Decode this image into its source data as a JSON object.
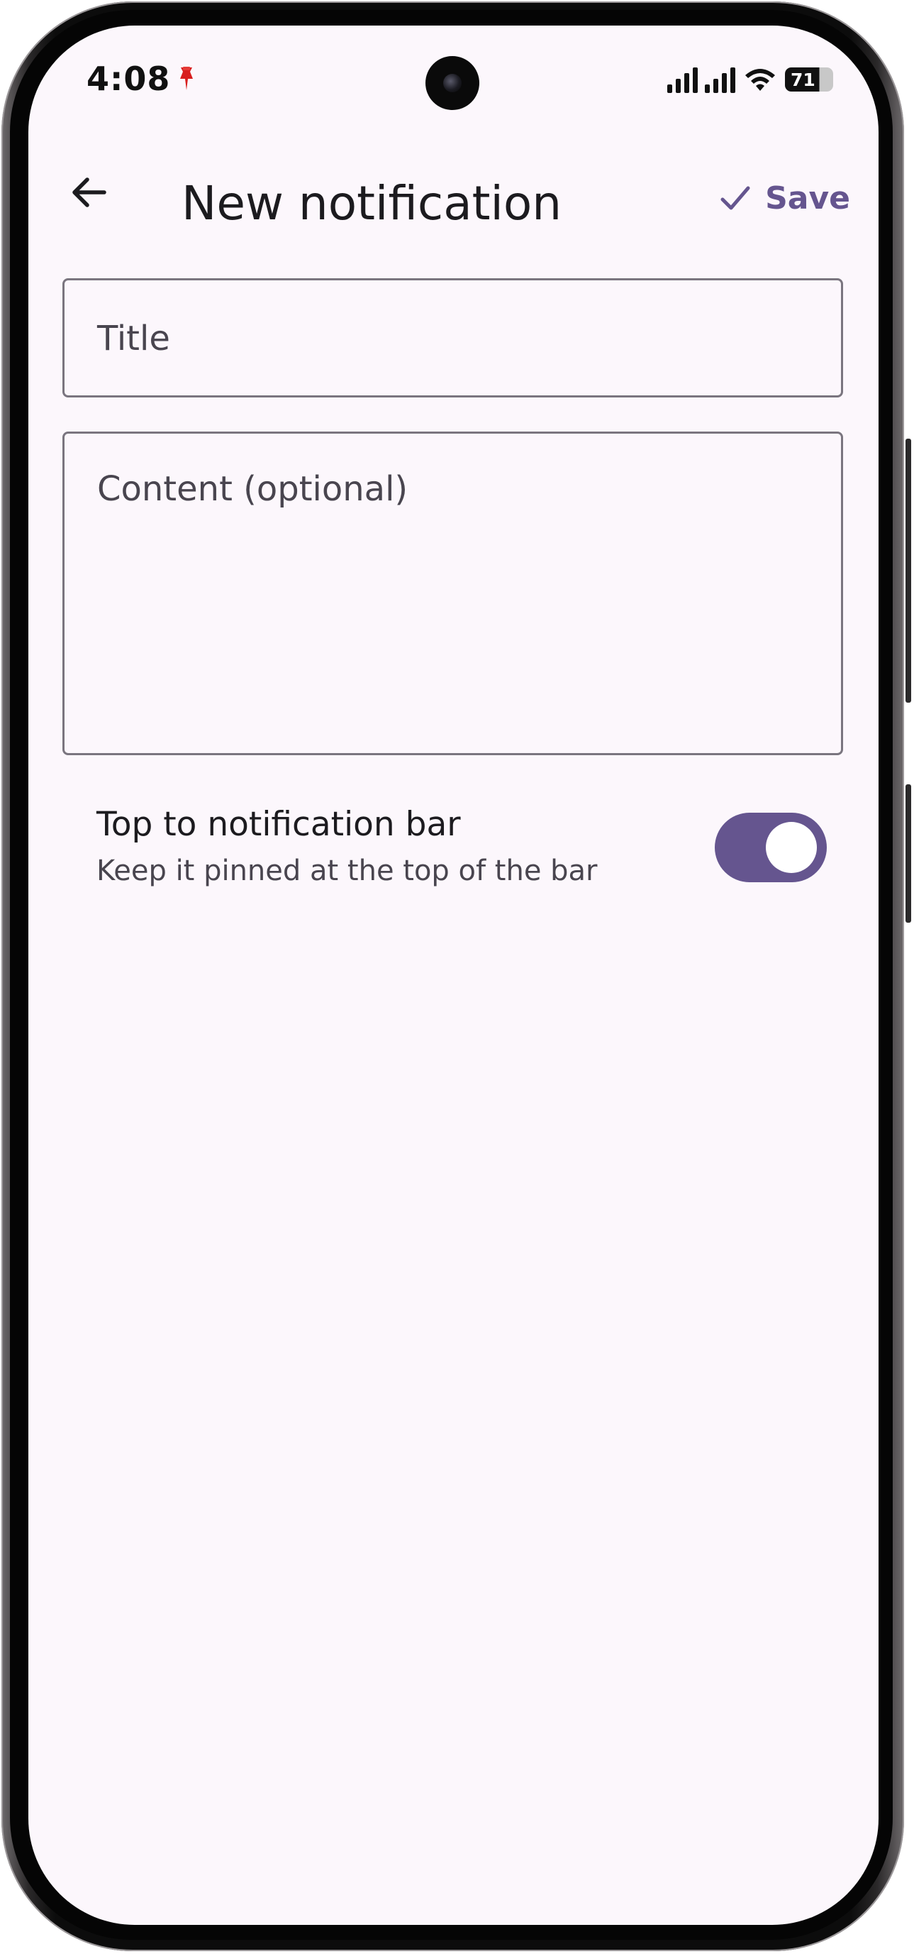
{
  "status_bar": {
    "time": "4:08",
    "battery": "71"
  },
  "app_bar": {
    "title": "New notification",
    "save_label": "Save",
    "back_icon": "arrow-back-icon",
    "save_icon": "check-icon"
  },
  "form": {
    "title_placeholder": "Title",
    "content_placeholder": "Content (optional)"
  },
  "setting": {
    "title": "Top to notification bar",
    "subtitle": "Keep it pinned at the top of the bar",
    "enabled": true
  },
  "colors": {
    "accent": "#65558f",
    "background": "#fcf7fc"
  }
}
